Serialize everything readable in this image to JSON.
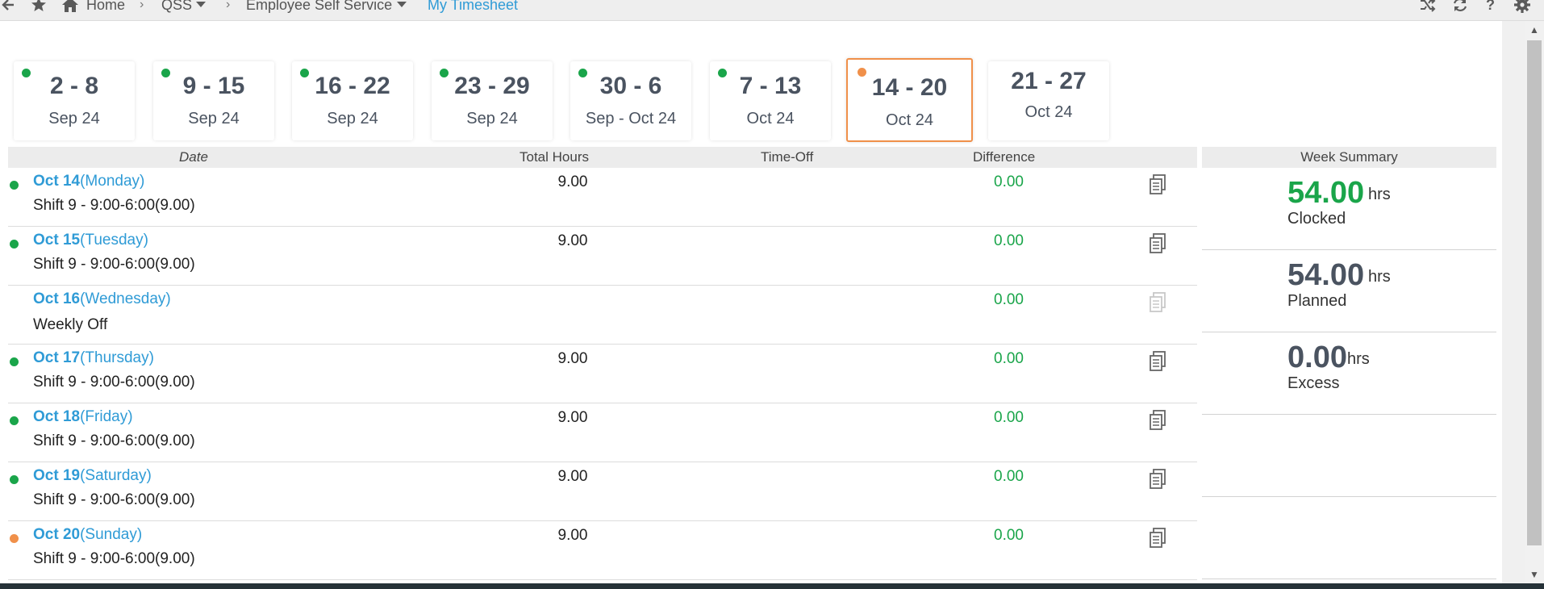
{
  "breadcrumb": {
    "home": "Home",
    "company": "QSS",
    "module": "Employee Self Service",
    "current": "My Timesheet"
  },
  "colors": {
    "accent": "#2f9bd6",
    "ok": "#1aa54a",
    "pending": "#f0904a",
    "active_border": "#f0904a"
  },
  "weeks": [
    {
      "range": "2 - 8",
      "month": "Sep 24",
      "status": "ok"
    },
    {
      "range": "9 - 15",
      "month": "Sep 24",
      "status": "ok"
    },
    {
      "range": "16 - 22",
      "month": "Sep 24",
      "status": "ok"
    },
    {
      "range": "23 - 29",
      "month": "Sep 24",
      "status": "ok"
    },
    {
      "range": "30 - 6",
      "month": "Sep - Oct 24",
      "status": "ok"
    },
    {
      "range": "7 - 13",
      "month": "Oct 24",
      "status": "ok"
    },
    {
      "range": "14 - 20",
      "month": "Oct 24",
      "status": "pending",
      "active": true
    },
    {
      "range": "21 - 27",
      "month": "Oct 24",
      "status": "none"
    }
  ],
  "table": {
    "headers": {
      "date": "Date",
      "total_hours": "Total Hours",
      "time_off": "Time-Off",
      "difference": "Difference"
    },
    "rows": [
      {
        "date": "Oct 14",
        "day": "(Monday)",
        "shift": "Shift 9 - 9:00-6:00(9.00)",
        "hours": "9.00",
        "difference": "0.00",
        "status": "ok"
      },
      {
        "date": "Oct 15",
        "day": "(Tuesday)",
        "shift": "Shift 9 - 9:00-6:00(9.00)",
        "hours": "9.00",
        "difference": "0.00",
        "status": "ok"
      },
      {
        "date": "Oct 16",
        "day": "(Wednesday)",
        "shift": "Weekly Off",
        "hours": "",
        "difference": "0.00",
        "status": "none"
      },
      {
        "date": "Oct 17",
        "day": "(Thursday)",
        "shift": "Shift 9 - 9:00-6:00(9.00)",
        "hours": "9.00",
        "difference": "0.00",
        "status": "ok"
      },
      {
        "date": "Oct 18",
        "day": "(Friday)",
        "shift": "Shift 9 - 9:00-6:00(9.00)",
        "hours": "9.00",
        "difference": "0.00",
        "status": "ok"
      },
      {
        "date": "Oct 19",
        "day": "(Saturday)",
        "shift": "Shift 9 - 9:00-6:00(9.00)",
        "hours": "9.00",
        "difference": "0.00",
        "status": "ok"
      },
      {
        "date": "Oct 20",
        "day": "(Sunday)",
        "shift": "Shift 9 - 9:00-6:00(9.00)",
        "hours": "9.00",
        "difference": "0.00",
        "status": "pending"
      }
    ]
  },
  "summary": {
    "title": "Week Summary",
    "items": [
      {
        "value": "54.00",
        "unit": "hrs",
        "label": "Clocked",
        "color": "#1aa54a"
      },
      {
        "value": "54.00",
        "unit": "hrs",
        "label": "Planned",
        "color": "#4a5360"
      },
      {
        "value": "0.00",
        "unit": "hrs",
        "label": "Excess",
        "color": "#4a5360"
      }
    ]
  }
}
